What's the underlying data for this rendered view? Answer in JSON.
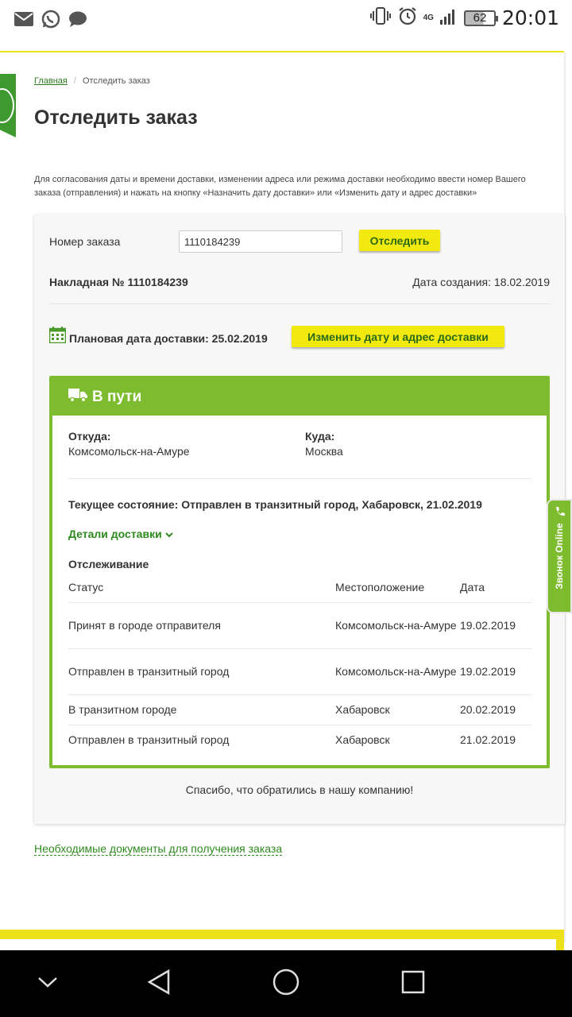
{
  "status_bar": {
    "time": "20:01",
    "battery": "62",
    "network": "4G",
    "notification_icons": [
      "mail-icon",
      "whatsapp-icon",
      "chat-icon"
    ],
    "system_icons": [
      "vibrate-icon",
      "alarm-icon",
      "signal-icon",
      "battery-icon"
    ]
  },
  "breadcrumb": {
    "home": "Главная",
    "separator": "/",
    "current": "Отследить заказ"
  },
  "page_title": "Отследить заказ",
  "intro": "Для согласования даты и времени доставки, изменении адреса или режима доставки необходимо ввести номер Вашего заказа (отправления) и нажать на кнопку «Назначить дату доставки» или «Изменить дату и адрес доставки»",
  "form": {
    "order_label": "Номер заказа",
    "order_value": "1110184239",
    "track_button": "Отследить"
  },
  "order": {
    "waybill": "Накладная № 1110184239",
    "created": "Дата создания: 18.02.2019",
    "planned_date": "Плановая дата доставки: 25.02.2019",
    "change_button": "Изменить дату и адрес доставки"
  },
  "status": {
    "title": "В пути",
    "from_label": "Откуда:",
    "from_value": "Комсомольск-на-Амуре",
    "to_label": "Куда:",
    "to_value": "Москва",
    "current": "Текущее состояние: Отправлен в транзитный город, Хабаровск, 21.02.2019",
    "details_link": "Детали доставки"
  },
  "tracking": {
    "title": "Отслеживание",
    "headers": [
      "Статус",
      "Местоположение",
      "Дата"
    ],
    "rows": [
      {
        "status": "Принят в городе отправителя",
        "location": "Комсомольск-на-Амуре",
        "date": "19.02.2019"
      },
      {
        "status": "Отправлен в транзитный город",
        "location": "Комсомольск-на-Амуре",
        "date": "19.02.2019"
      },
      {
        "status": "В транзитном городе",
        "location": "Хабаровск",
        "date": "20.02.2019"
      },
      {
        "status": "Отправлен в транзитный город",
        "location": "Хабаровск",
        "date": "21.02.2019"
      }
    ]
  },
  "thanks": "Спасибо, что обратились в нашу компанию!",
  "docs_link": "Необходимые документы для получения заказа",
  "callback_tab": "Звонок Online",
  "colors": {
    "brand_green": "#7dbc2e",
    "link_green": "#2e8a1f",
    "button_yellow": "#f2ea0f"
  }
}
